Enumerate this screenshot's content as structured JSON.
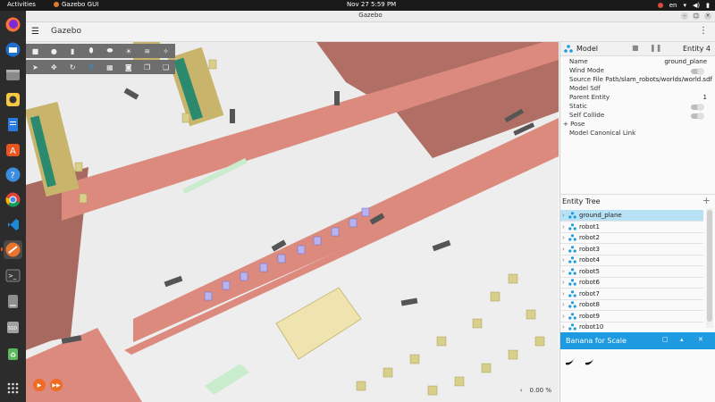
{
  "topbar": {
    "activities": "Activities",
    "app_name": "Gazebo GUI",
    "clock": "Nov 27  5:59 PM",
    "lang": "en"
  },
  "dock": {
    "items": [
      "firefox",
      "thunderbird",
      "files",
      "rhythmbox",
      "libreoffice-writer",
      "app-store",
      "help",
      "chrome",
      "vscode",
      "gazebo",
      "terminal",
      "disk",
      "ssd-disk",
      "trash",
      "show-apps"
    ]
  },
  "window": {
    "title": "Gazebo",
    "app_title": "Gazebo"
  },
  "toolbar": {
    "row1": [
      "box-icon",
      "sphere-icon",
      "cylinder-icon",
      "capsule-icon",
      "ellipsoid-icon",
      "sun-icon",
      "directional-light-icon",
      "spot-light-icon"
    ],
    "row2": [
      "select-icon",
      "translate-icon",
      "rotate-icon",
      "snap-icon",
      "grid-icon",
      "camera-icon",
      "copy-icon",
      "paste-icon"
    ]
  },
  "component_inspector": {
    "title": "Model",
    "entity": "Entity 4",
    "rows": [
      {
        "key": "Name",
        "value": "ground_plane"
      },
      {
        "key": "Wind Mode",
        "value": ""
      },
      {
        "key": "Source File Path",
        "value": ".../slam_robots/worlds/world.sdf"
      },
      {
        "key": "Model Sdf",
        "value": ""
      },
      {
        "key": "Parent Entity",
        "value": "1"
      },
      {
        "key": "Static",
        "value": ""
      },
      {
        "key": "Self Collide",
        "value": ""
      },
      {
        "key": "+ Pose",
        "value": ""
      },
      {
        "key": "Model Canonical Link",
        "value": ""
      }
    ]
  },
  "entity_tree": {
    "title": "Entity Tree",
    "items": [
      "ground_plane",
      "robot1",
      "robot2",
      "robot3",
      "robot4",
      "robot5",
      "robot6",
      "robot7",
      "robot8",
      "robot9",
      "robot10"
    ]
  },
  "banana": {
    "title": "Banana for Scale"
  },
  "playback": {
    "rtf": "0.00 %"
  },
  "colors": {
    "accent": "#1e9ae0",
    "selected_row": "#b7e1f4",
    "play": "#ef6c23",
    "wall": "#d9867b",
    "roof": "#b06e64"
  }
}
